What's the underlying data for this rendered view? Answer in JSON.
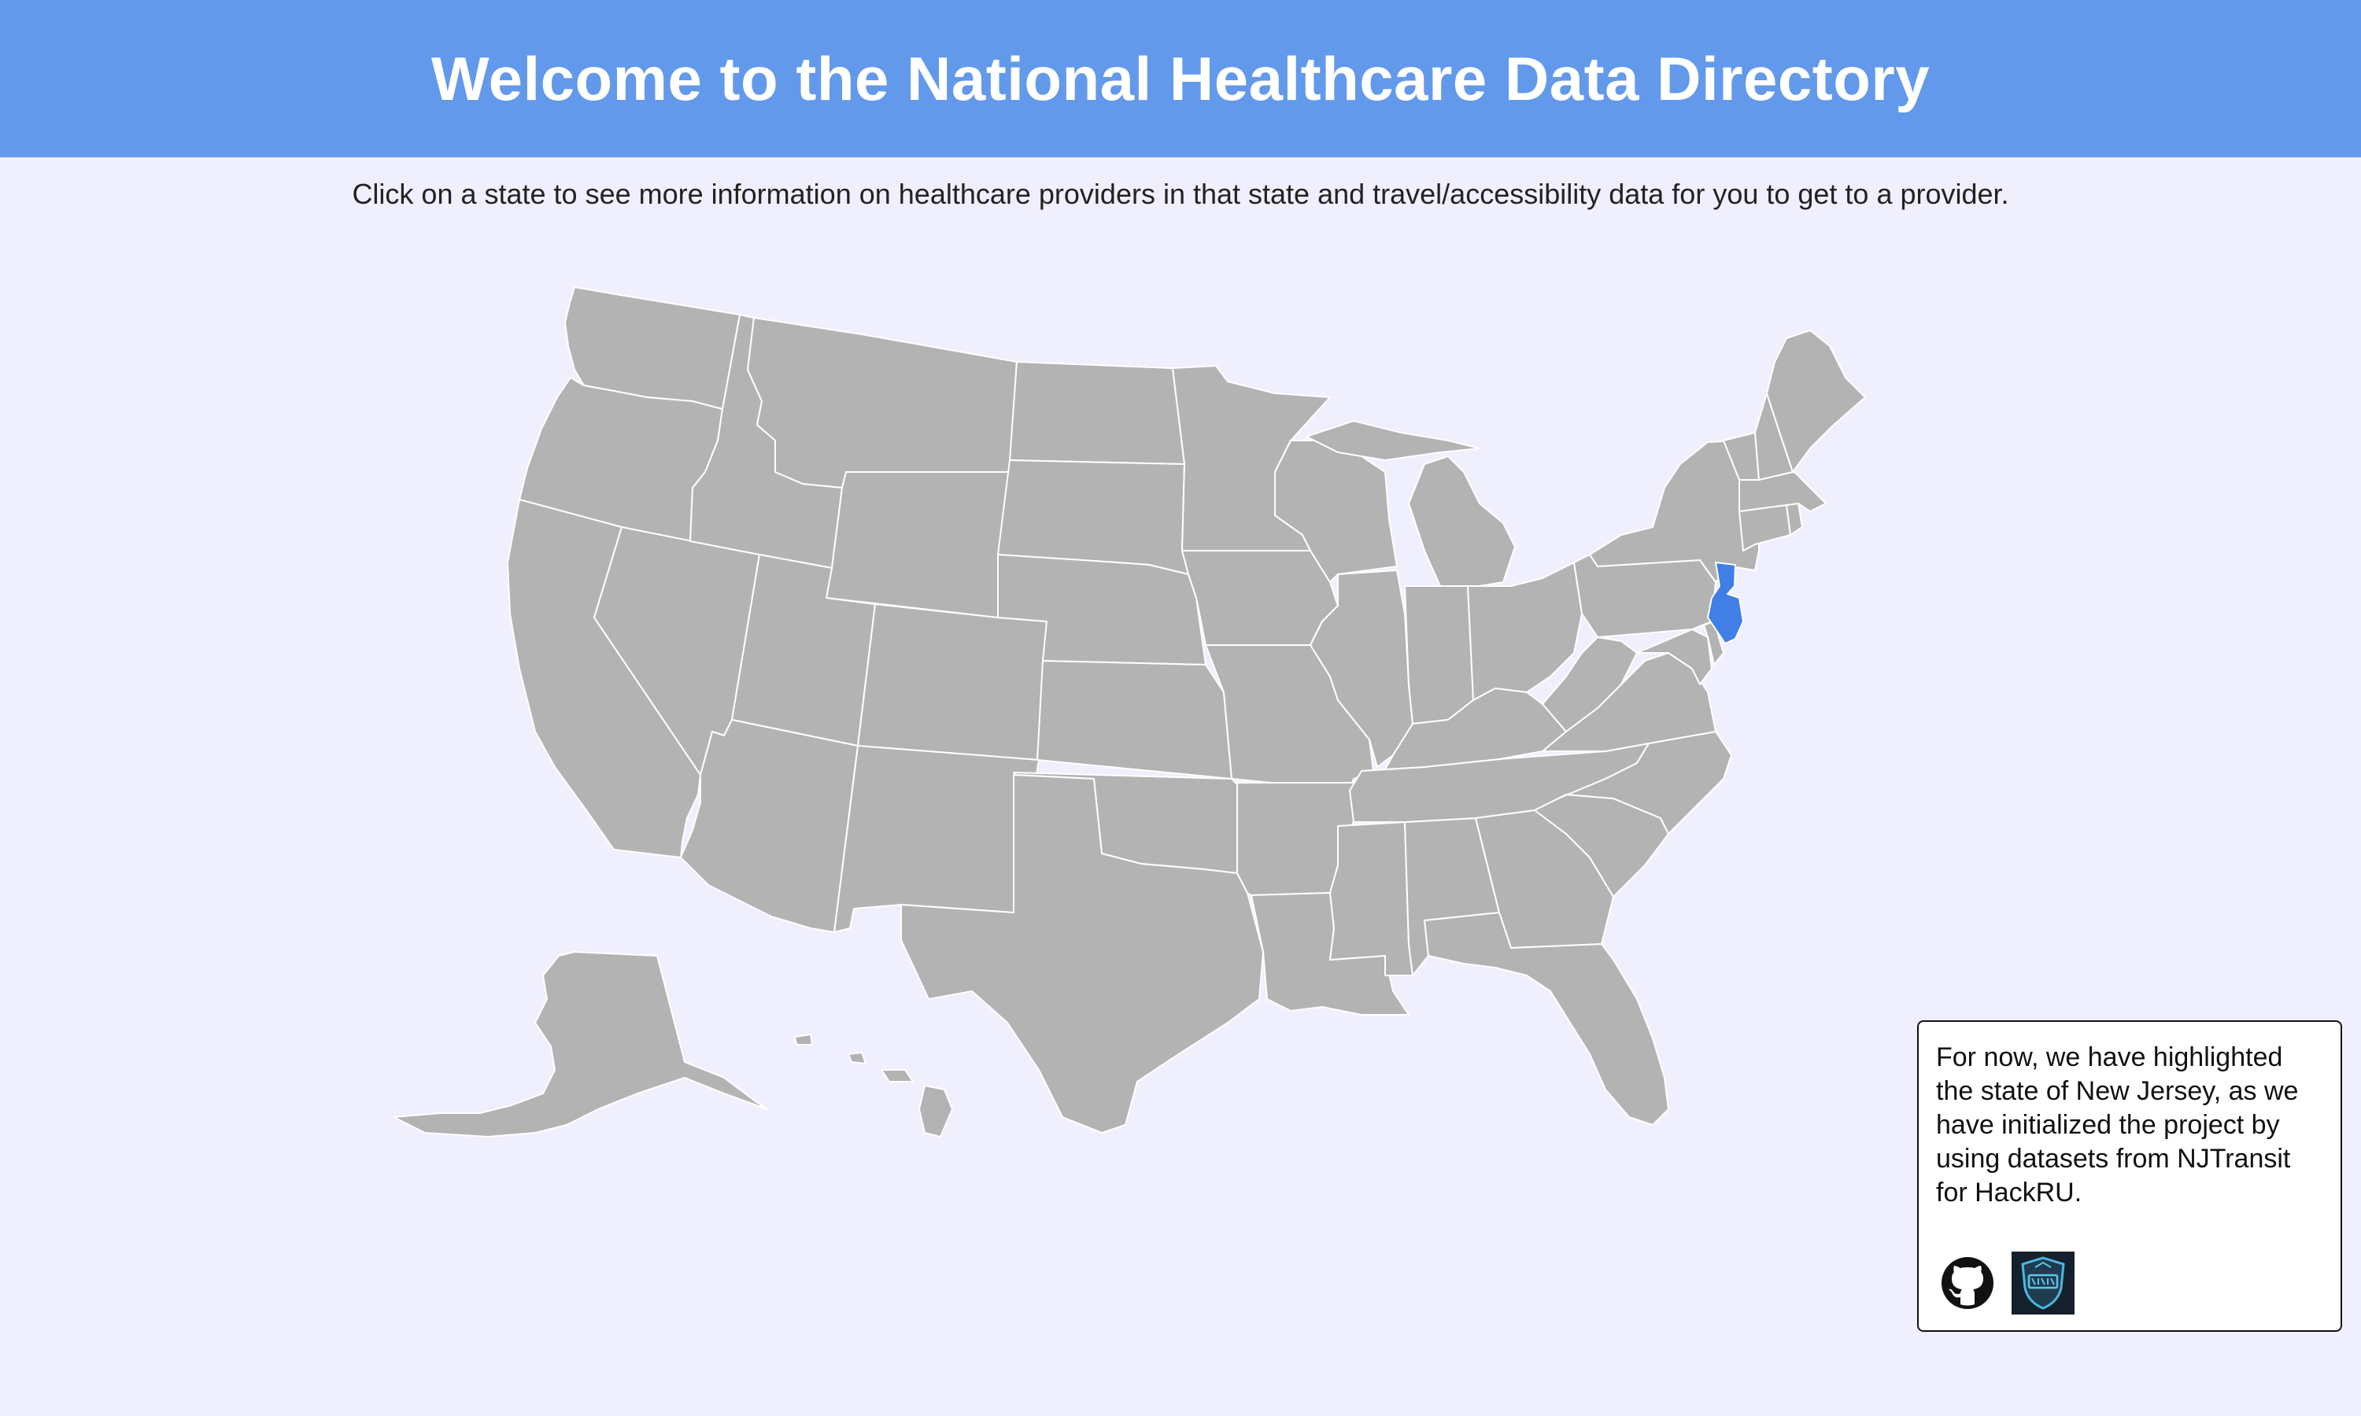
{
  "header": {
    "title": "Welcome to the National Healthcare Data Directory"
  },
  "intro": {
    "text": "Click on a state to see more information on healthcare providers in that state and travel/accessibility data for you to get to a provider."
  },
  "map": {
    "default_state_color": "#b3b3b3",
    "highlight_color": "#3f7fe6",
    "border_color": "#ffffff",
    "highlighted_state": "New Jersey"
  },
  "info_box": {
    "text": "For now, we have highlighted the state of New Jersey, as we have initialized the project by using datasets from NJTransit for HackRU.",
    "links": [
      {
        "icon": "github-icon"
      },
      {
        "icon": "hackru-logo"
      }
    ]
  },
  "colors": {
    "header_bg": "#6399ea",
    "page_bg": "#f0effe"
  }
}
